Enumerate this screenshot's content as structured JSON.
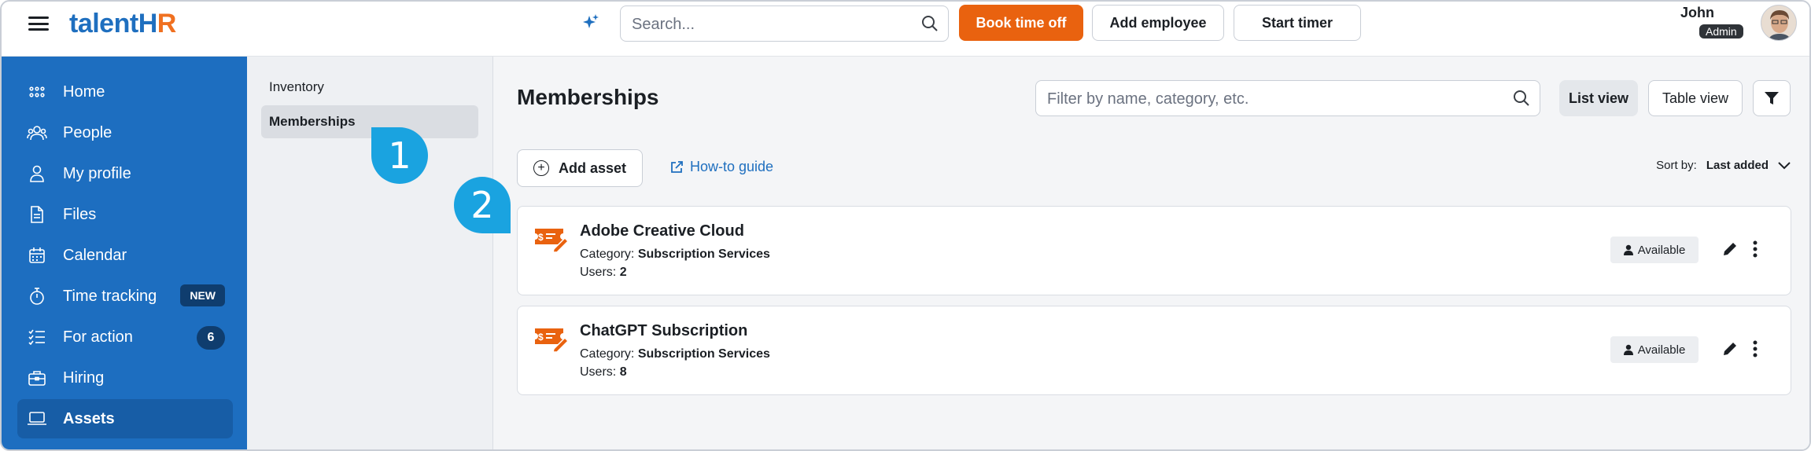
{
  "header": {
    "logo": {
      "part1": "talent",
      "part2": "H",
      "part3": "R"
    },
    "search_placeholder": "Search...",
    "book_time_off": "Book time off",
    "add_employee": "Add employee",
    "start_timer": "Start timer",
    "user_name": "John",
    "user_role": "Admin"
  },
  "sidebar": {
    "items": [
      {
        "label": "Home",
        "icon": "grid-icon"
      },
      {
        "label": "People",
        "icon": "people-icon"
      },
      {
        "label": "My profile",
        "icon": "user-icon"
      },
      {
        "label": "Files",
        "icon": "file-icon"
      },
      {
        "label": "Calendar",
        "icon": "calendar-icon"
      },
      {
        "label": "Time tracking",
        "icon": "stopwatch-icon",
        "badge": "NEW"
      },
      {
        "label": "For action",
        "icon": "checklist-icon",
        "badge": "6"
      },
      {
        "label": "Hiring",
        "icon": "briefcase-icon"
      },
      {
        "label": "Assets",
        "icon": "laptop-icon"
      }
    ],
    "active": "Assets"
  },
  "subnav": {
    "items": [
      "Inventory",
      "Memberships"
    ],
    "active": "Memberships"
  },
  "main": {
    "title": "Memberships",
    "filter_placeholder": "Filter by name, category, etc.",
    "list_view": "List view",
    "table_view": "Table view",
    "add_asset": "Add asset",
    "how_to_guide": "How-to guide",
    "sort_label": "Sort by:",
    "sort_value": "Last added",
    "cards": [
      {
        "name": "Adobe Creative Cloud",
        "category_label": "Category:",
        "category": "Subscription Services",
        "users_label": "Users:",
        "users": "2",
        "status": "Available"
      },
      {
        "name": "ChatGPT Subscription",
        "category_label": "Category:",
        "category": "Subscription Services",
        "users_label": "Users:",
        "users": "8",
        "status": "Available"
      }
    ]
  },
  "callouts": [
    "1",
    "2"
  ],
  "colors": {
    "brand_blue": "#1d6ec0",
    "brand_orange": "#e9620f",
    "callout_blue": "#1aa3e0"
  }
}
